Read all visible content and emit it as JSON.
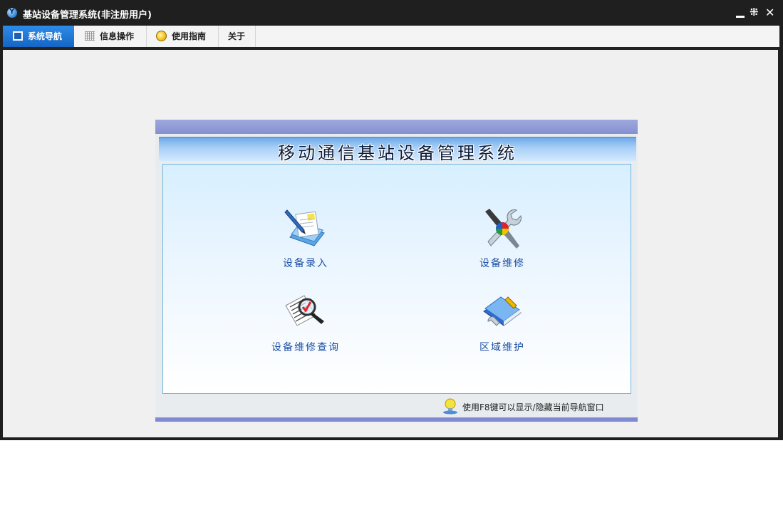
{
  "window": {
    "title": "基站设备管理系统(非注册用户)",
    "app_icon_letter": "Y"
  },
  "menubar": {
    "tabs": [
      {
        "label": "系统导航",
        "icon": "monitor-icon",
        "active": true
      },
      {
        "label": "信息操作",
        "icon": "grid-icon",
        "active": false
      },
      {
        "label": "使用指南",
        "icon": "lightbulb-icon",
        "active": false
      },
      {
        "label": "关于",
        "icon": "",
        "active": false
      }
    ]
  },
  "panel": {
    "title": "移动通信基站设备管理系统",
    "items": [
      {
        "label": "设备录入",
        "icon": "document-pen-icon"
      },
      {
        "label": "设备维修",
        "icon": "tools-icon"
      },
      {
        "label": "设备维修查询",
        "icon": "magnifier-document-icon"
      },
      {
        "label": "区域维护",
        "icon": "book-wrench-icon"
      }
    ],
    "hint": "使用F8键可以显示/隐藏当前导航窗口"
  },
  "colors": {
    "titlebar_bg": "#1f1f1f",
    "active_tab": "#1c72d6",
    "item_label": "#1d4fa3",
    "panel_header": "#8590d0"
  }
}
